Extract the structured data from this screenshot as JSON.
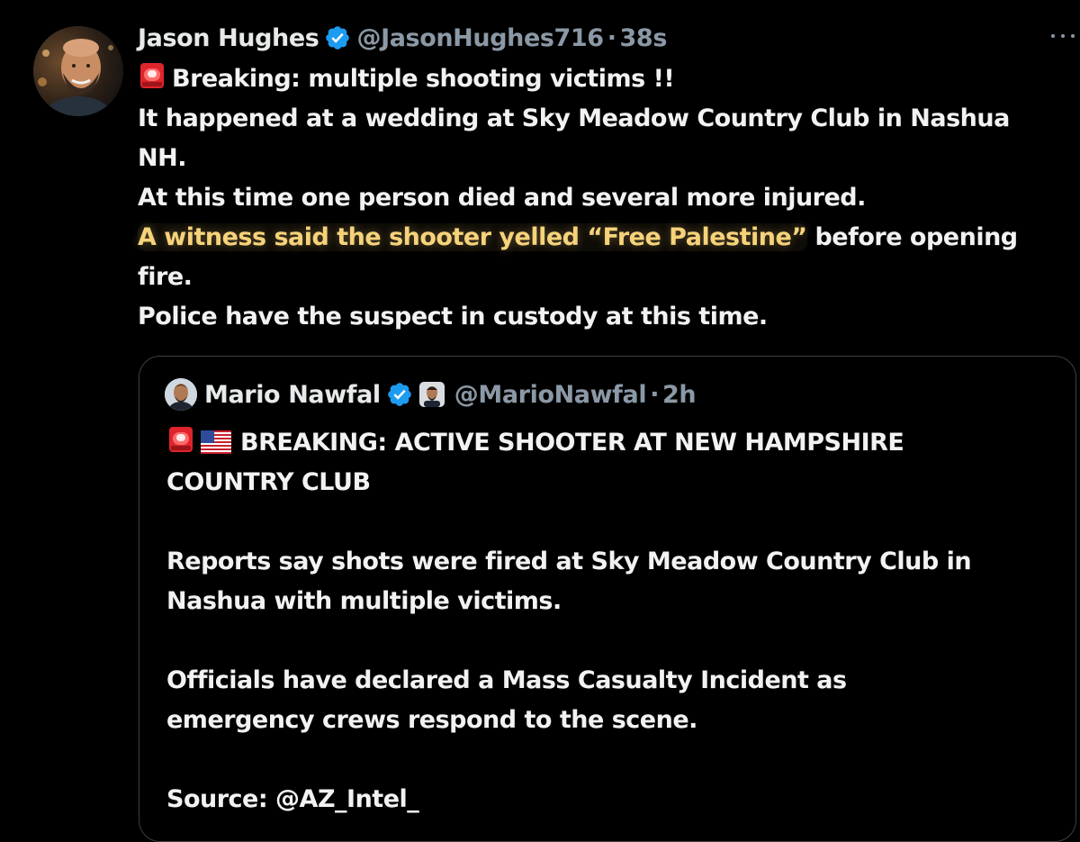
{
  "tweet": {
    "author": {
      "name": "Jason Hughes",
      "handle": "@JasonHughes716",
      "separator": "·",
      "time": "38s",
      "verified": true,
      "avatar": "avatar-photo"
    },
    "more_icon": "more-dots-icon",
    "lines": [
      "Breaking: multiple shooting victims !!",
      "It happened at a wedding at Sky Meadow Country Club in Nashua",
      "NH.",
      "At this time one person died and several more injured.",
      "A witness said the shooter yelled “Free Palestine”",
      " before opening",
      "fire.",
      "Police have the suspect in custody at this time."
    ],
    "highlight_color": "#f6d27a"
  },
  "quoted": {
    "author": {
      "name": "Mario Nawfal",
      "handle": "@MarioNawfal",
      "separator": "·",
      "time": "2h",
      "verified": true
    },
    "headline_1": "BREAKING: ACTIVE SHOOTER AT NEW HAMPSHIRE",
    "headline_2": "COUNTRY CLUB",
    "para_1_line_1": "Reports say shots were fired at Sky Meadow Country Club in",
    "para_1_line_2": "Nashua with multiple victims.",
    "para_2_line_1": "Officials have declared a Mass Casualty Incident as",
    "para_2_line_2": "emergency crews respond to the scene.",
    "source": "Source: @AZ_Intel_"
  },
  "colors": {
    "background": "#000000",
    "text": "#e7e9ea",
    "secondary": "#8b98a5",
    "verified": "#1d9bf0",
    "border": "#3b3f44"
  }
}
